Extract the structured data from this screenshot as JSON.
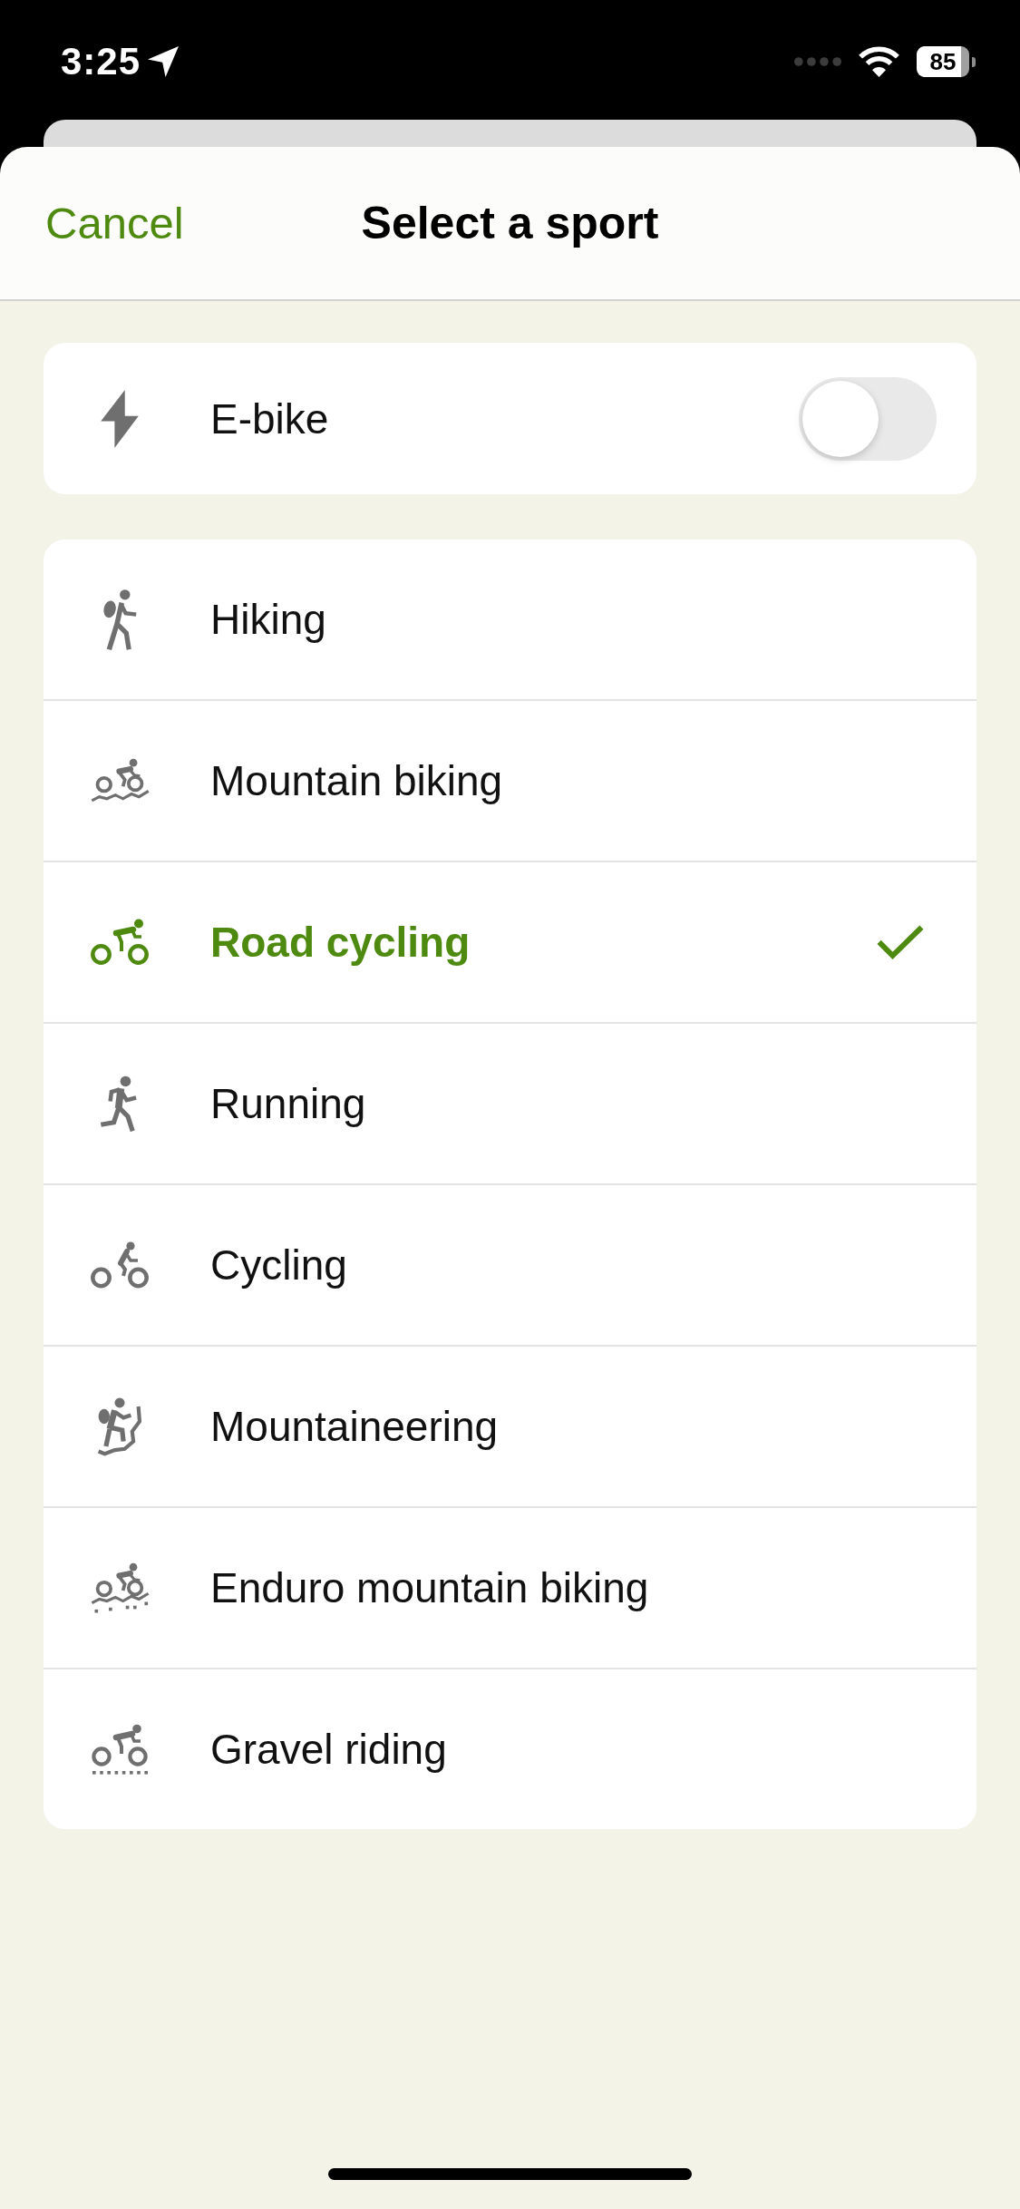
{
  "status_bar": {
    "time": "3:25",
    "battery": "85"
  },
  "header": {
    "cancel": "Cancel",
    "title": "Select a sport"
  },
  "ebike": {
    "label": "E-bike",
    "on": false
  },
  "sports": [
    {
      "label": "Hiking",
      "kind": "hiking",
      "selected": false
    },
    {
      "label": "Mountain biking",
      "kind": "mtb",
      "selected": false
    },
    {
      "label": "Road cycling",
      "kind": "road",
      "selected": true
    },
    {
      "label": "Running",
      "kind": "running",
      "selected": false
    },
    {
      "label": "Cycling",
      "kind": "cycling",
      "selected": false
    },
    {
      "label": "Mountaineering",
      "kind": "mountaineering",
      "selected": false
    },
    {
      "label": "Enduro mountain biking",
      "kind": "enduro",
      "selected": false
    },
    {
      "label": "Gravel riding",
      "kind": "gravel",
      "selected": false
    }
  ]
}
